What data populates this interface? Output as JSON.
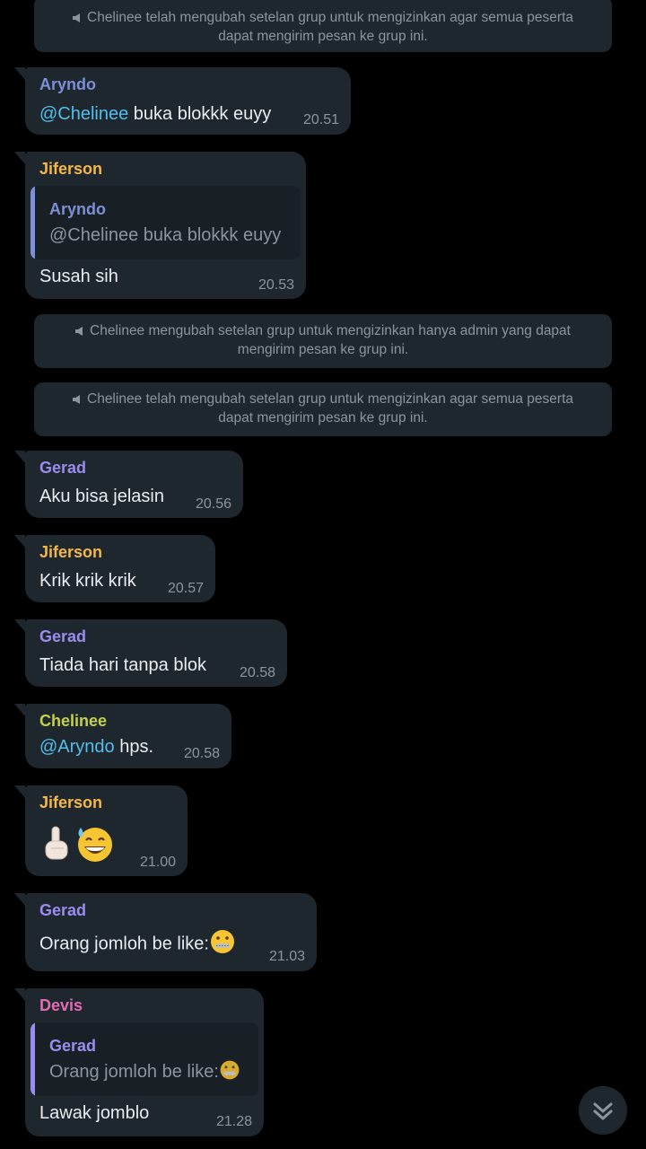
{
  "colors": {
    "bubble": "#1f272e",
    "quote_bg": "#182025",
    "arynd o": "#7d8fd6",
    "jiferson": "#f5b847",
    "gerad": "#9b8cf0",
    "chelinee": "#c5d04a",
    "devis": "#e06bb3",
    "mention": "#53bdeb",
    "meta": "#8a959c"
  },
  "system_messages": [
    "Chelinee telah mengubah setelan grup untuk mengizinkan agar semua peserta dapat mengirim pesan ke grup ini.",
    "Chelinee mengubah setelan grup untuk mengizinkan hanya admin yang dapat mengirim pesan ke grup ini.",
    "Chelinee telah mengubah setelan grup untuk mengizinkan agar semua peserta dapat mengirim pesan ke grup ini."
  ],
  "messages": [
    {
      "sender": "Aryndo",
      "mention": "@Chelinee",
      "text": " buka blokkk euyy",
      "time": "20.51"
    },
    {
      "sender": "Jiferson",
      "reply_to": {
        "sender": "Aryndo",
        "text": "@Chelinee buka blokkk euyy"
      },
      "text": "Susah sih",
      "time": "20.53"
    },
    {
      "sender": "Gerad",
      "text": "Aku bisa jelasin",
      "time": "20.56"
    },
    {
      "sender": "Jiferson",
      "text": "Krik krik krik",
      "time": "20.57"
    },
    {
      "sender": "Gerad",
      "text": "Tiada hari tanpa blok",
      "time": "20.58"
    },
    {
      "sender": "Chelinee",
      "mention": "@Aryndo",
      "text": " hps.",
      "time": "20.58"
    },
    {
      "sender": "Jiferson",
      "emojis": [
        "pointing-up-hand-icon",
        "grinning-sweat-face-icon"
      ],
      "time": "21.00"
    },
    {
      "sender": "Gerad",
      "text": "Orang jomloh be like:",
      "emoji": "zipper-mouth-face-icon",
      "time": "21.03"
    },
    {
      "sender": "Devis",
      "reply_to": {
        "sender": "Gerad",
        "text": "Orang jomloh be like:"
      },
      "text": "Lawak jomblo",
      "time": "21.28"
    }
  ],
  "scroll_button": {
    "icon": "double-chevron-down-icon"
  }
}
